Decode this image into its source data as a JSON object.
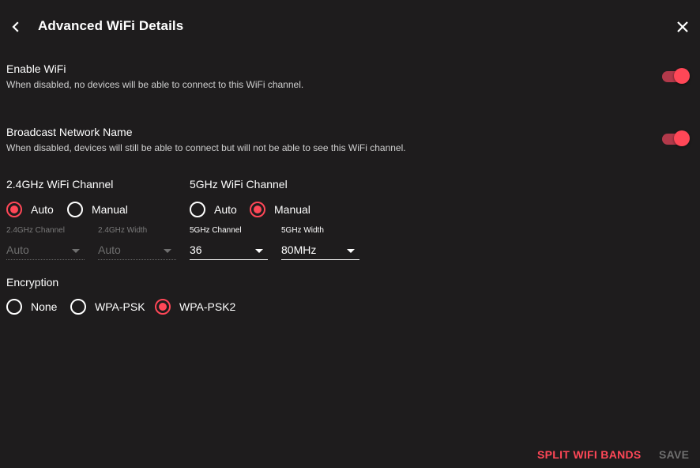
{
  "header": {
    "title": "Advanced WiFi Details",
    "back_icon": "chevron-left-icon",
    "close_icon": "close-icon"
  },
  "settings": {
    "enable_wifi": {
      "title": "Enable WiFi",
      "description": "When disabled, no devices will be able to connect to this WiFi channel.",
      "on": true
    },
    "broadcast_name": {
      "title": "Broadcast Network Name",
      "description": "When disabled, devices will still be able to connect but will not be able to see this WiFi channel.",
      "on": true
    }
  },
  "channel_24": {
    "heading": "2.4GHz WiFi Channel",
    "options": [
      "Auto",
      "Manual"
    ],
    "selected": "Auto",
    "channel_label": "2.4GHz Channel",
    "channel_value": "Auto",
    "width_label": "2.4GHz Width",
    "width_value": "Auto",
    "disabled": true
  },
  "channel_5": {
    "heading": "5GHz WiFi Channel",
    "options": [
      "Auto",
      "Manual"
    ],
    "selected": "Manual",
    "channel_label": "5GHz Channel",
    "channel_value": "36",
    "width_label": "5GHz Width",
    "width_value": "80MHz",
    "disabled": false
  },
  "encryption": {
    "heading": "Encryption",
    "options": [
      "None",
      "WPA-PSK",
      "WPA-PSK2"
    ],
    "selected": "WPA-PSK2"
  },
  "footer": {
    "split_label": "SPLIT WIFI BANDS",
    "save_label": "SAVE"
  },
  "colors": {
    "background": "#1e1c1d",
    "accent": "#ff4757",
    "accent_track": "#b2394a",
    "disabled_text": "#6f6f6f"
  }
}
